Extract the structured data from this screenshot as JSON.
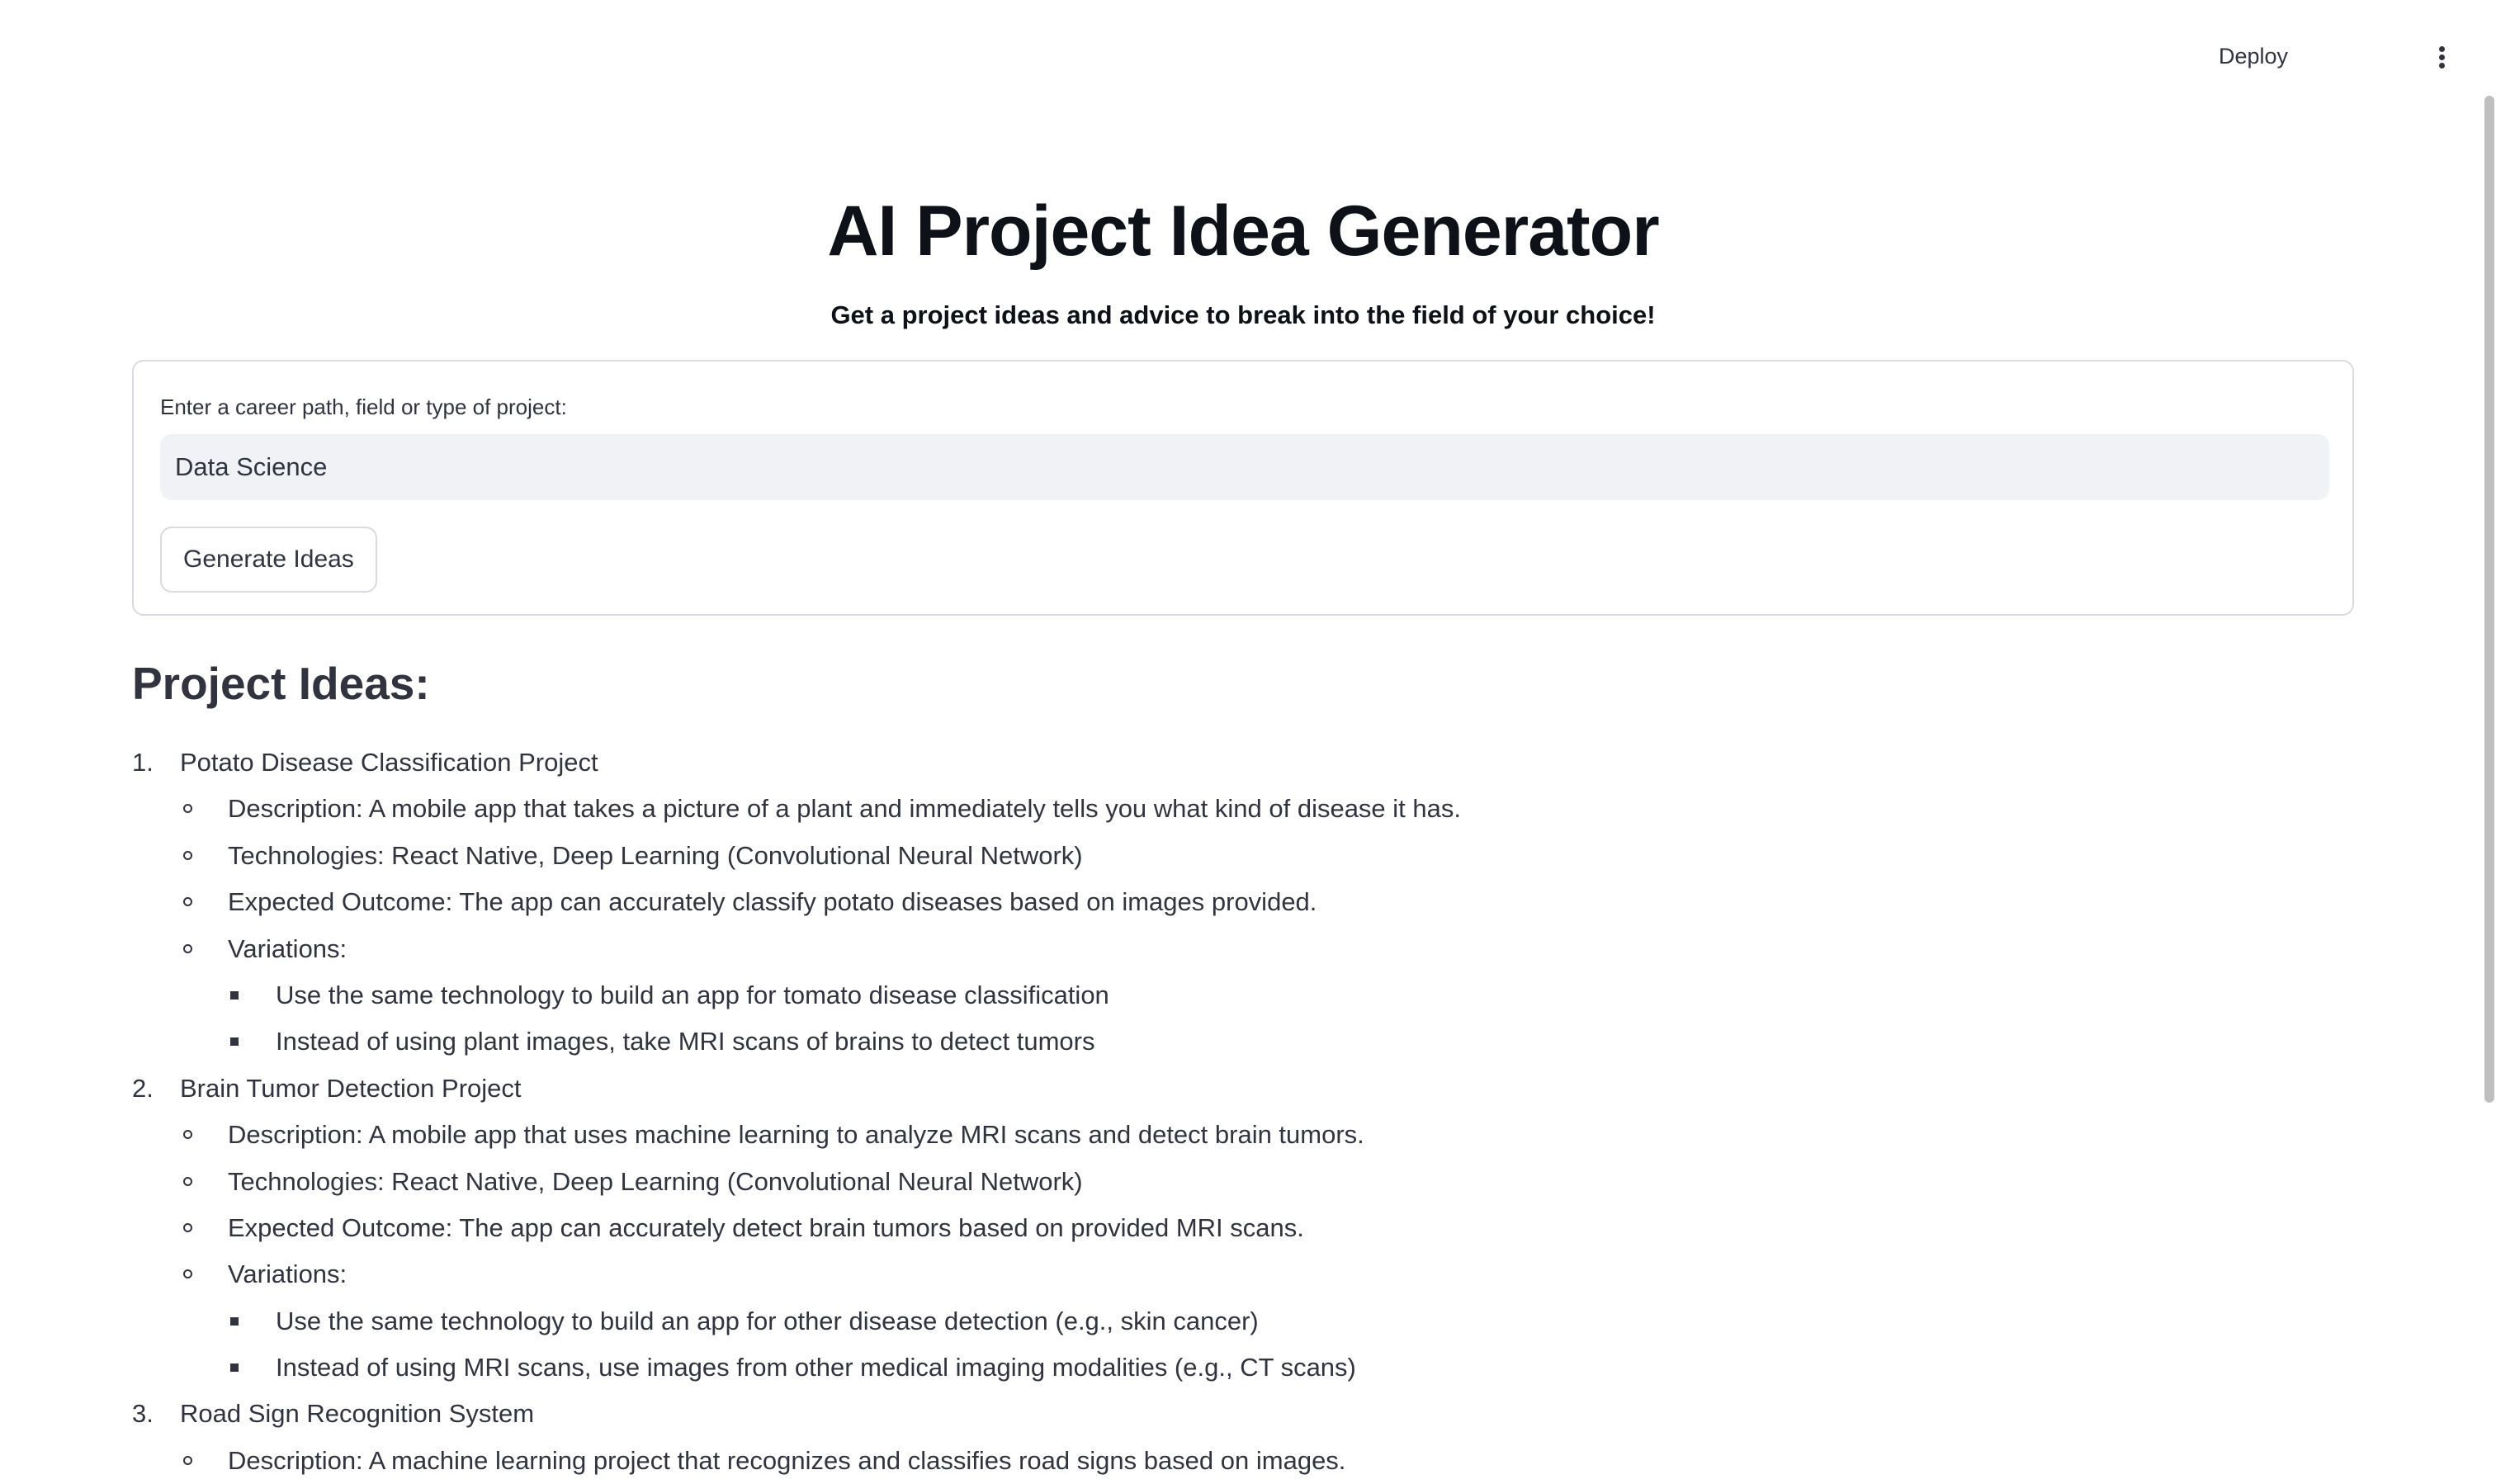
{
  "toolbar": {
    "deploy_label": "Deploy"
  },
  "header": {
    "title": "AI Project Idea Generator",
    "subtitle": "Get a project ideas and advice to break into the field of your choice!"
  },
  "form": {
    "input_label": "Enter a career path, field or type of project:",
    "input_value": "Data Science",
    "button_label": "Generate Ideas"
  },
  "results": {
    "heading": "Project Ideas:",
    "ideas": [
      {
        "number": "1.",
        "title": "Potato Disease Classification Project",
        "details": [
          "Description: A mobile app that takes a picture of a plant and immediately tells you what kind of disease it has.",
          "Technologies: React Native, Deep Learning (Convolutional Neural Network)",
          "Expected Outcome: The app can accurately classify potato diseases based on images provided.",
          "Variations:"
        ],
        "variations": [
          "Use the same technology to build an app for tomato disease classification",
          "Instead of using plant images, take MRI scans of brains to detect tumors"
        ]
      },
      {
        "number": "2.",
        "title": "Brain Tumor Detection Project",
        "details": [
          "Description: A mobile app that uses machine learning to analyze MRI scans and detect brain tumors.",
          "Technologies: React Native, Deep Learning (Convolutional Neural Network)",
          "Expected Outcome: The app can accurately detect brain tumors based on provided MRI scans.",
          "Variations:"
        ],
        "variations": [
          "Use the same technology to build an app for other disease detection (e.g., skin cancer)",
          "Instead of using MRI scans, use images from other medical imaging modalities (e.g., CT scans)"
        ]
      },
      {
        "number": "3.",
        "title": "Road Sign Recognition System",
        "details": [
          "Description: A machine learning project that recognizes and classifies road signs based on images."
        ],
        "variations": []
      }
    ]
  }
}
